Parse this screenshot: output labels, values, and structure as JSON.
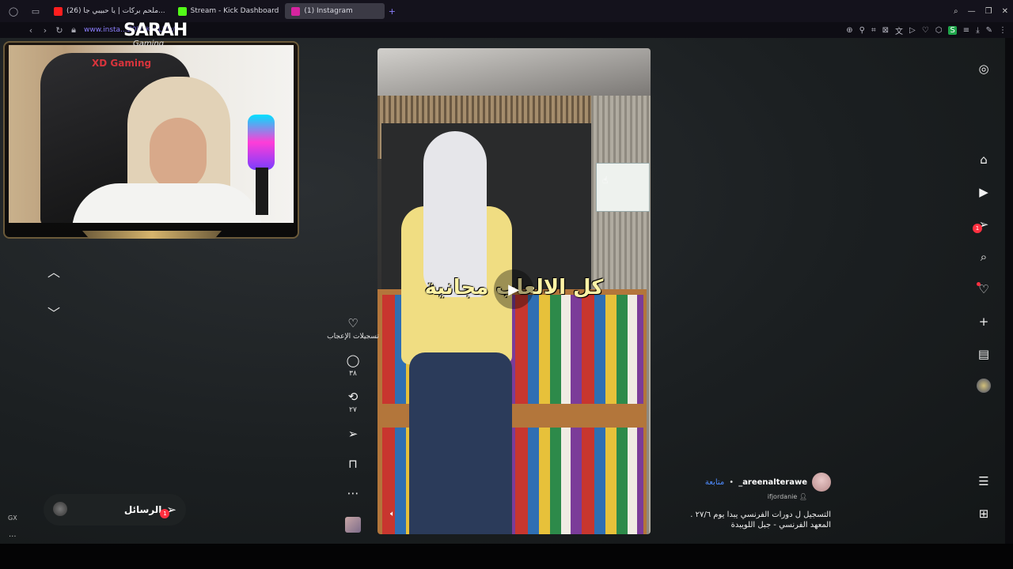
{
  "browser": {
    "tabs": [
      {
        "label": "(26) ملحم بركات | يا حبيبي جا...",
        "icon_color": "#ff1e1e",
        "active": false
      },
      {
        "label": "Stream - Kick Dashboard",
        "icon_color": "#53fc18",
        "active": false
      },
      {
        "label": "(1) Instagram",
        "icon_color": "#d6249f",
        "active": true
      }
    ],
    "new_tab_icon": "plus-icon",
    "url": "www.insta...Z0kUKiOLMv/"
  },
  "overlay": {
    "logo": "SARAH",
    "logo_sub": "Gaming",
    "chair_brand": "XD Gaming"
  },
  "reel": {
    "caption": "كل الالعاب مجانية",
    "actions": {
      "likes_label": "تسجيلات الإعجاب",
      "comments_count": "٣٨",
      "reposts_count": "٢٧"
    }
  },
  "author": {
    "username": "areenalterawe_",
    "follow_label": "متابعة",
    "collaborator": "ifjordanie",
    "description_line1": "التسجيل ل دورات الفرنسي يبدا يوم ٢٧/٦ .",
    "description_line2": "المعهد الفرنسي - جبل اللويبدة"
  },
  "nav": {
    "messages_badge": "1"
  },
  "messages": {
    "label": "الرسائل",
    "badge": "1"
  },
  "sidebar_bottom": {
    "gx": "GX",
    "more": "..."
  }
}
